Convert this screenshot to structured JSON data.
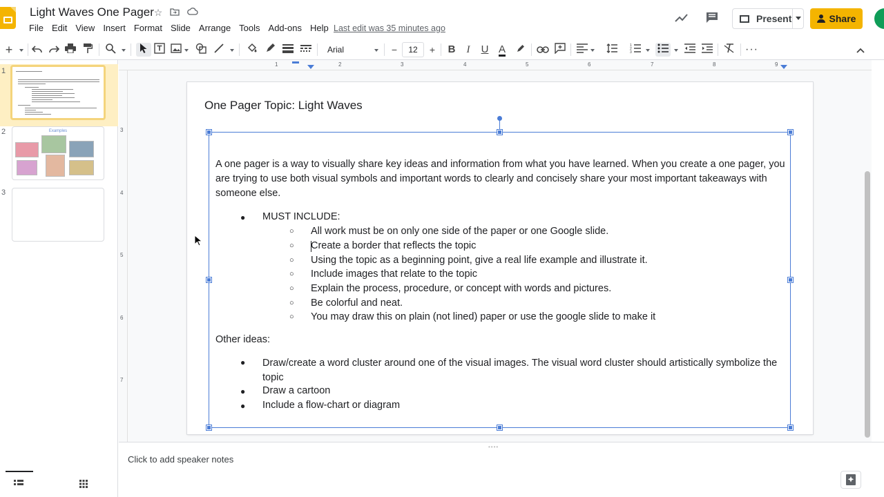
{
  "header": {
    "doc_title": "Light Waves One Pager",
    "menu": [
      "File",
      "Edit",
      "View",
      "Insert",
      "Format",
      "Slide",
      "Arrange",
      "Tools",
      "Add-ons",
      "Help"
    ],
    "last_edit": "Last edit was 35 minutes ago",
    "present_label": "Present",
    "share_label": "Share"
  },
  "toolbar": {
    "font": "Arial",
    "font_size": "12"
  },
  "ruler": {
    "top": [
      "1",
      "2",
      "3",
      "4",
      "5",
      "6",
      "7",
      "8",
      "9"
    ],
    "left": [
      "3",
      "4",
      "5",
      "6",
      "7"
    ]
  },
  "filmstrip": {
    "numbers": [
      "1",
      "2",
      "3"
    ],
    "slide2_title": "Examples"
  },
  "slide": {
    "title": "One Pager Topic: Light Waves",
    "intro": "A one pager is a way to visually share key ideas and information from what you have learned. When you create a one pager, you are trying to use both visual symbols and important words to clearly and concisely share your most important takeaways with someone else.",
    "must_include_label": "MUST INCLUDE:",
    "must_include_items": [
      "All work must be on only one side of the paper  or one Google slide.",
      "Create a border that reflects the topic",
      "Using the topic as a beginning point, give a real life example and illustrate it.",
      "Include images that relate to the topic",
      "Explain the process, procedure, or concept with words and pictures.",
      "Be colorful and neat.",
      "You may draw this on plain (not lined)  paper or use the google slide to make it"
    ],
    "other_ideas_label": "Other ideas:",
    "other_ideas_items": [
      "Draw/create a word cluster around one of the visual images. The visual word cluster should artistically symbolize the topic",
      "Draw a cartoon",
      "Include a flow-chart or diagram"
    ]
  },
  "notes": {
    "placeholder": "Click to add speaker notes"
  },
  "colors": {
    "accent": "#f4b400",
    "selection": "#4a7cd6"
  }
}
